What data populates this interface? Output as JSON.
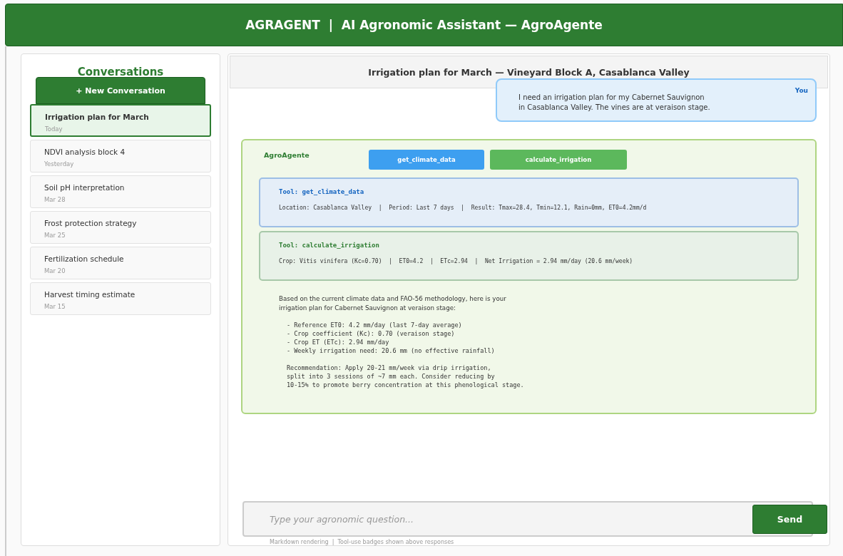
{
  "app_bar": {
    "title": "AGRAGENT  |  AI Agronomic Assistant — AgroAgente"
  },
  "sidebar": {
    "title": "Conversations",
    "new_button": "+ New Conversation",
    "items": [
      {
        "title": "Irrigation plan for March",
        "date": "Today",
        "selected": true
      },
      {
        "title": "NDVI analysis block 4",
        "date": "Yesterday",
        "selected": false
      },
      {
        "title": "Soil pH interpretation",
        "date": "Mar 28",
        "selected": false
      },
      {
        "title": "Frost protection strategy",
        "date": "Mar 25",
        "selected": false
      },
      {
        "title": "Fertilization schedule",
        "date": "Mar 20",
        "selected": false
      },
      {
        "title": "Harvest timing estimate",
        "date": "Mar 15",
        "selected": false
      }
    ]
  },
  "chat": {
    "title": "Irrigation plan for March — Vineyard Block A, Casablanca Valley",
    "user_message": {
      "author": "You",
      "text": "I need an irrigation plan for my Cabernet Sauvignon\nin Casablanca Valley. The vines are at veraison stage."
    },
    "agent_message": {
      "author": "AgroAgente",
      "badges": [
        {
          "label": "get_climate_data",
          "color": "#3d9ff0"
        },
        {
          "label": "calculate_irrigation",
          "color": "#5cb85c"
        }
      ],
      "tool_results": [
        {
          "title": "Tool: get_climate_data",
          "text": "Location: Casablanca Valley  |  Period: Last 7 days  |  Result: Tmax=28.4, Tmin=12.1, Rain=0mm, ET0=4.2mm/d",
          "color": "#1565c0"
        },
        {
          "title": "Tool: calculate_irrigation",
          "text": "Crop: Vitis vinifera (Kc=0.70)  |  ET0=4.2  |  ETc=2.94  |  Net Irrigation = 2.94 mm/day (20.6 mm/week)",
          "color": "#2e7d32"
        }
      ],
      "intro": "Based on the current climate data and FAO-56 methodology, here is your\nirrigation plan for Cabernet Sauvignon at veraison stage:",
      "bullets": [
        "- Reference ET0: 4.2 mm/day (last 7-day average)",
        "- Crop coefficient (Kc): 0.70 (veraison stage)",
        "- Crop ET (ETc): 2.94 mm/day",
        "- Weekly irrigation need: 20.6 mm (no effective rainfall)"
      ],
      "recommendation": "Recommendation: Apply 20-21 mm/week via drip irrigation,\nsplit into 3 sessions of ~7 mm each. Consider reducing by\n10-15% to promote berry concentration at this phenological stage."
    },
    "input": {
      "placeholder": "Type your agronomic question...",
      "send": "Send"
    },
    "footer_note": "Markdown rendering  |  Tool-use badges shown above responses"
  }
}
